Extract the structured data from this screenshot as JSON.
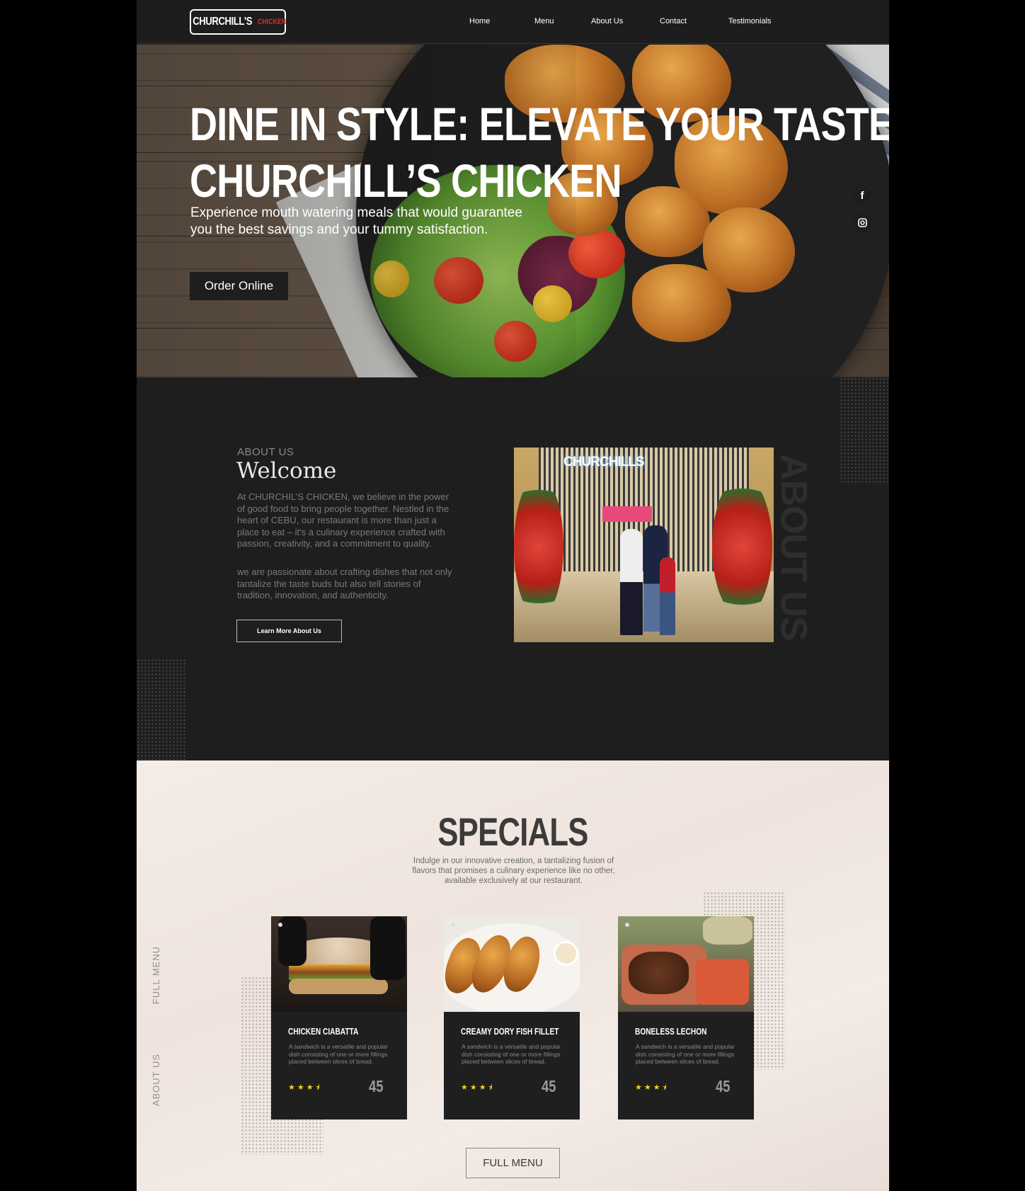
{
  "brand": {
    "name": "CHURCHILL'S",
    "accent": "CHICKEN",
    "accent_color": "#e22a2a"
  },
  "nav": {
    "items": [
      "Home",
      "Menu",
      "About Us",
      "Contact",
      "Testimonials"
    ]
  },
  "hero": {
    "title_line1": "DINE IN STYLE: ELEVATE YOUR TASTES AT",
    "title_line2": "CHURCHILL’S CHICKEN",
    "subtitle": "Experience mouth  watering meals that would guarantee you the best savings and your tummy satisfaction.",
    "cta": "Order Online",
    "social": [
      "facebook-icon",
      "instagram-icon"
    ]
  },
  "about": {
    "label": "ABOUT  US",
    "title": "Welcome",
    "para1": "At CHURCHIL’S CHICKEN, we believe in the power of good food to bring people together. Nestled in the heart of CEBU, our restaurant is more than just a place to eat – it's a culinary experience crafted with passion, creativity, and a commitment to quality.",
    "para2": "we are passionate about crafting dishes that not only tantalize the taste buds but also tell stories of tradition, innovation, and authenticity.",
    "cta": "Learn More About Us",
    "photo_sign": "CHURCHILLS",
    "vertical_label": "ABOUT US"
  },
  "specials": {
    "title": "SPECIALS",
    "subtitle": "Indulge in our  innovative creation, a tantalizing fusion of flavors that promises a culinary experience like no other, available exclusively at our restaurant.",
    "side_full_menu": "FULL MENU",
    "side_about_us": "ABOUT US",
    "items": [
      {
        "name": "CHICKEN CIABATTA",
        "desc": "A sandwich is a versatile and popular dish consisting of one or more fillings placed between slices of bread.",
        "rating": 3.5,
        "stars": "★★★⯨",
        "price": "45"
      },
      {
        "name": "CREAMY DORY FISH FILLET",
        "desc": "A sandwich is a versatile and popular dish consisting of one or more fillings placed between slices of bread.",
        "rating": 3.5,
        "stars": "★★★⯨",
        "price": "45"
      },
      {
        "name": "BONELESS LECHON",
        "desc": "A sandwich is a versatile and popular dish consisting of one or more fillings placed between slices of bread.",
        "rating": 3.5,
        "stars": "★★★⯨",
        "price": "45"
      }
    ],
    "cta": "FULL MENU"
  }
}
